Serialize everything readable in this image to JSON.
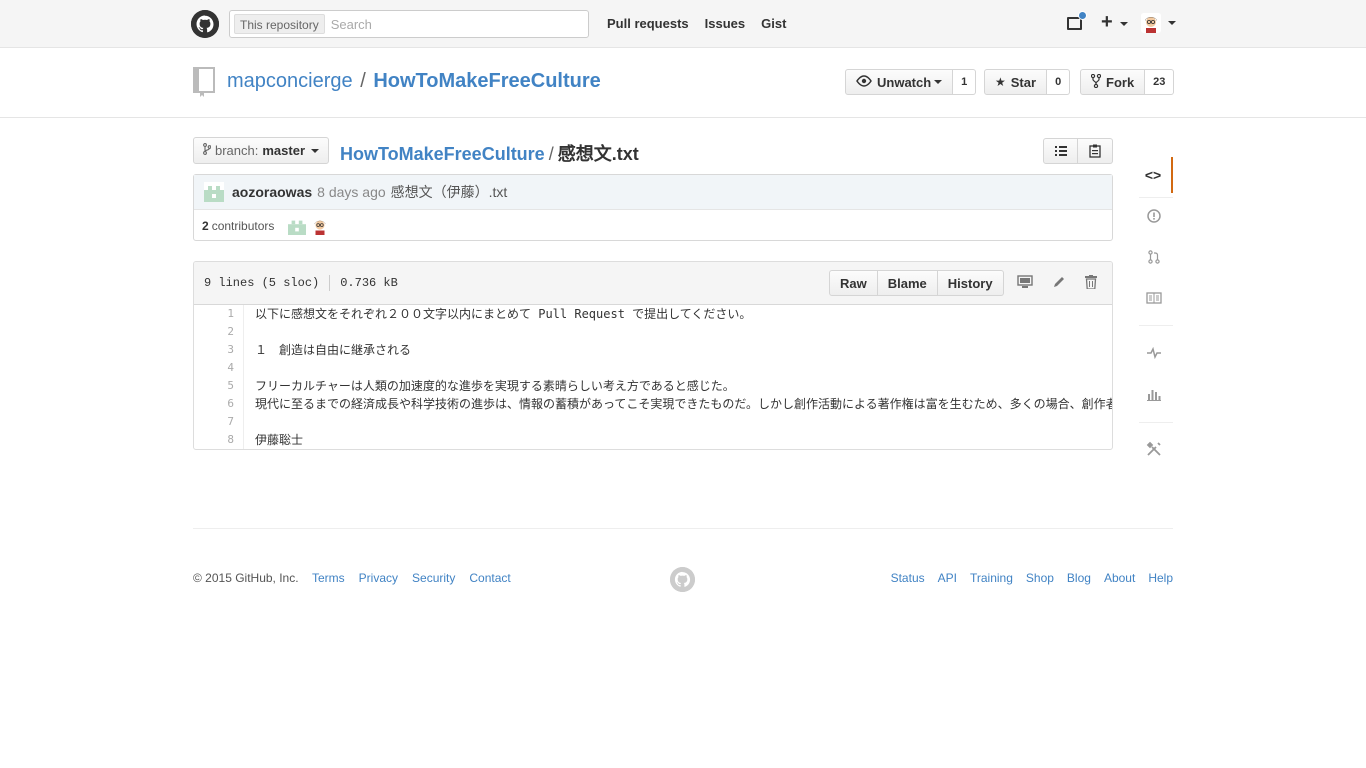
{
  "header": {
    "search_scope": "This repository",
    "search_placeholder": "Search",
    "nav": [
      "Pull requests",
      "Issues",
      "Gist"
    ],
    "plus_label": "+"
  },
  "repo": {
    "owner": "mapconcierge",
    "separator": "/",
    "name": "HowToMakeFreeCulture",
    "watch_label": "Unwatch",
    "watch_count": "1",
    "star_label": "Star",
    "star_count": "0",
    "fork_label": "Fork",
    "fork_count": "23"
  },
  "file": {
    "branch_prefix": "branch:",
    "branch": "master",
    "breadcrumb_root": "HowToMakeFreeCulture",
    "breadcrumb_sep": "/",
    "filename": "感想文.txt",
    "commit_author": "aozoraowas",
    "commit_age": "8 days ago",
    "commit_message": "感想文（伊藤）.txt",
    "contributors_count": "2",
    "contributors_label": "contributors",
    "lines_info": "9 lines (5 sloc)",
    "size": "0.736 kB",
    "buttons": [
      "Raw",
      "Blame",
      "History"
    ],
    "lines": [
      {
        "n": "1",
        "text": "以下に感想文をそれぞれ２００文字以内にまとめて Pull Request で提出してください。"
      },
      {
        "n": "2",
        "text": ""
      },
      {
        "n": "3",
        "text": "１　創造は自由に継承される"
      },
      {
        "n": "4",
        "text": ""
      },
      {
        "n": "5",
        "text": "フリーカルチャーは人類の加速度的な進歩を実現する素晴らしい考え方であると感じた。"
      },
      {
        "n": "6",
        "text": "現代に至るまでの経済成長や科学技術の進歩は、情報の蓄積があってこそ実現できたものだ。しかし創作活動による著作権は富を生むため、多くの場合、創作者"
      },
      {
        "n": "7",
        "text": ""
      },
      {
        "n": "8",
        "text": "伊藤聡士"
      }
    ]
  },
  "sidebar": {
    "items": [
      "code-icon",
      "issues-icon",
      "pull-request-icon",
      "wiki-icon",
      "pulse-icon",
      "graphs-icon",
      "settings-icon"
    ]
  },
  "footer": {
    "copyright": "© 2015 GitHub, Inc.",
    "left_links": [
      "Terms",
      "Privacy",
      "Security",
      "Contact"
    ],
    "right_links": [
      "Status",
      "API",
      "Training",
      "Shop",
      "Blog",
      "About",
      "Help"
    ]
  },
  "colors": {
    "link": "#4183c4",
    "header_bg": "#f5f5f5",
    "commit_bg": "#f1f5f8",
    "active_tab": "#d26911",
    "notification_dot": "#4183c4"
  }
}
